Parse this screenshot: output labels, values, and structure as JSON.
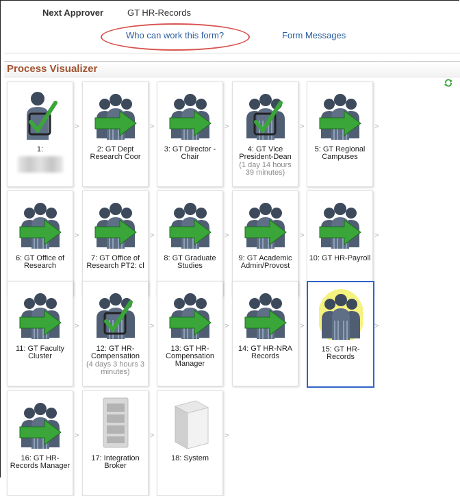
{
  "header": {
    "next_approver_label": "Next Approver",
    "next_approver_value": "GT HR-Records",
    "who_can_work_link": "Who can work this form?",
    "form_messages_link": "Form Messages"
  },
  "section": {
    "title": "Process Visualizer"
  },
  "arrow_glyph": ">",
  "steps": [
    {
      "label": "1:",
      "icon": "approved-person-icon",
      "duration": ""
    },
    {
      "label": "2: GT Dept Research Coor",
      "icon": "group-arrow-icon",
      "duration": ""
    },
    {
      "label": "3: GT Director - Chair",
      "icon": "group-arrow-icon",
      "duration": ""
    },
    {
      "label": "4: GT Vice President-Dean",
      "icon": "group-approved-icon",
      "duration": "(1 day 14 hours 39 minutes)"
    },
    {
      "label": "5: GT Regional Campuses",
      "icon": "group-arrow-icon",
      "duration": ""
    },
    {
      "label": "6: GT Office of Research",
      "icon": "group-arrow-icon",
      "duration": ""
    },
    {
      "label": "7: GT Office of Research PT2: cl",
      "icon": "group-arrow-icon",
      "duration": ""
    },
    {
      "label": "8: GT Graduate Studies",
      "icon": "group-arrow-icon",
      "duration": ""
    },
    {
      "label": "9: GT Academic Admin/Provost",
      "icon": "group-arrow-icon",
      "duration": ""
    },
    {
      "label": "10: GT HR-Payroll",
      "icon": "group-arrow-icon",
      "duration": ""
    },
    {
      "label": "11: GT Faculty Cluster",
      "icon": "group-arrow-icon",
      "duration": ""
    },
    {
      "label": "12: GT HR-Compensation",
      "icon": "group-approved-icon",
      "duration": "(4 days 3 hours 3 minutes)"
    },
    {
      "label": "13: GT HR-Compensation Manager",
      "icon": "group-arrow-icon",
      "duration": ""
    },
    {
      "label": "14: GT HR-NRA Records",
      "icon": "group-arrow-icon",
      "duration": ""
    },
    {
      "label": "15: GT HR-Records",
      "icon": "group-current-icon",
      "duration": ""
    },
    {
      "label": "16: GT HR-Records Manager",
      "icon": "group-arrow-icon",
      "duration": ""
    },
    {
      "label": "17: Integration Broker",
      "icon": "server-rack-icon",
      "duration": ""
    },
    {
      "label": "18: System",
      "icon": "computer-tower-icon",
      "duration": ""
    }
  ],
  "colors": {
    "link": "#2a5d9e",
    "section_title": "#a0522d",
    "current_border": "#2f63c7",
    "arrow_green": "#3aa63a"
  }
}
